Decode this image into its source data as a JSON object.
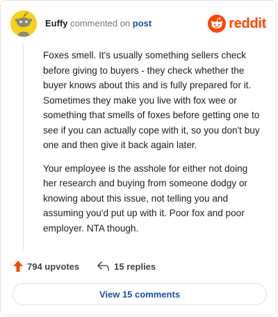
{
  "header": {
    "username": "Euffy",
    "action_text": "commented on",
    "post_link": "post",
    "brand": "reddit"
  },
  "comment": {
    "paragraphs": [
      "Foxes smell. It's usually something sellers check before giving to buyers - they check whether the buyer knows about this and is fully prepared for it. Sometimes they make you live with fox wee or something that smells of foxes before getting one to see if you can actually cope with it, so you don't buy one and then give it back again later.",
      "Your employee is the asshole for either not doing her research and buying from someone dodgy or knowing about this issue, not telling you and assuming you'd put up with it. Poor fox and poor employer. NTA though."
    ]
  },
  "stats": {
    "upvotes": "794 upvotes",
    "replies": "15 replies"
  },
  "footer": {
    "view_label": "View 15 comments"
  },
  "colors": {
    "brand": "#ff4500",
    "link": "#1a4fa0",
    "avatar": "#f5d21c"
  },
  "icons": [
    "snoo-avatar-icon",
    "reddit-logo-icon",
    "upvote-arrow-icon",
    "reply-arrow-icon"
  ]
}
